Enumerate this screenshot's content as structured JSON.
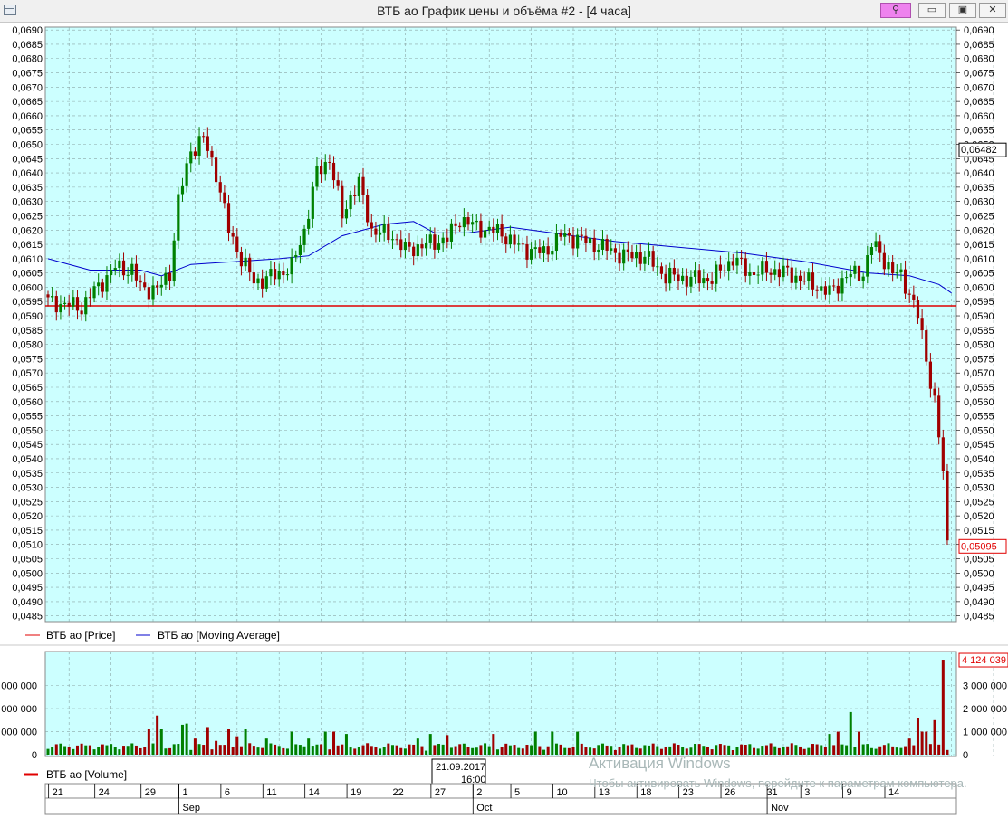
{
  "window": {
    "title": "ВТБ ао График цены и объёма #2 - [4 часа]",
    "buttons": {
      "pin": "⚲",
      "minimize": "▭",
      "restore": "▣",
      "close": "✕"
    }
  },
  "colors": {
    "up": "#008000",
    "down": "#a00000",
    "ma": "#0000cc",
    "level": "#e00000",
    "background": "#ccffff"
  },
  "chart_data": [
    {
      "type": "candlestick",
      "title": "",
      "price_axis": {
        "min": 0.0483,
        "max": 0.0691,
        "ticks": [
          "0,0485",
          "0,0490",
          "0,0495",
          "0,0500",
          "0,0505",
          "0,0510",
          "0,0515",
          "0,0520",
          "0,0525",
          "0,0530",
          "0,0535",
          "0,0540",
          "0,0545",
          "0,0550",
          "0,0555",
          "0,0560",
          "0,0565",
          "0,0570",
          "0,0575",
          "0,0580",
          "0,0585",
          "0,0590",
          "0,0595",
          "0,0600",
          "0,0605",
          "0,0610",
          "0,0615",
          "0,0620",
          "0,0625",
          "0,0630",
          "0,0635",
          "0,0640",
          "0,0645",
          "0,0650",
          "0,0655",
          "0,0660",
          "0,0665",
          "0,0670",
          "0,0675",
          "0,0680",
          "0,0685",
          "0,0690"
        ]
      },
      "horizontal_line": 0.05935,
      "price_labels": {
        "moving_average_last": "0,06482",
        "price_last": "0,05095"
      },
      "legend": [
        "ВТБ ао [Price]",
        "ВТБ ао [Moving Average]"
      ],
      "anchors": [
        {
          "i": 0,
          "p": 0.0595
        },
        {
          "i": 8,
          "p": 0.0593
        },
        {
          "i": 10,
          "p": 0.0597
        },
        {
          "i": 13,
          "p": 0.0602
        },
        {
          "i": 16,
          "p": 0.0607
        },
        {
          "i": 20,
          "p": 0.0606
        },
        {
          "i": 22,
          "p": 0.06
        },
        {
          "i": 26,
          "p": 0.0599
        },
        {
          "i": 29,
          "p": 0.0605
        },
        {
          "i": 31,
          "p": 0.063
        },
        {
          "i": 34,
          "p": 0.0648
        },
        {
          "i": 37,
          "p": 0.0652
        },
        {
          "i": 40,
          "p": 0.064
        },
        {
          "i": 43,
          "p": 0.062
        },
        {
          "i": 46,
          "p": 0.061
        },
        {
          "i": 49,
          "p": 0.0602
        },
        {
          "i": 52,
          "p": 0.0603
        },
        {
          "i": 55,
          "p": 0.0605
        },
        {
          "i": 58,
          "p": 0.0607
        },
        {
          "i": 61,
          "p": 0.062
        },
        {
          "i": 64,
          "p": 0.064
        },
        {
          "i": 67,
          "p": 0.0645
        },
        {
          "i": 70,
          "p": 0.0625
        },
        {
          "i": 72,
          "p": 0.0632
        },
        {
          "i": 74,
          "p": 0.0636
        },
        {
          "i": 77,
          "p": 0.062
        },
        {
          "i": 82,
          "p": 0.0618
        },
        {
          "i": 85,
          "p": 0.0613
        },
        {
          "i": 90,
          "p": 0.0615
        },
        {
          "i": 95,
          "p": 0.0617
        },
        {
          "i": 98,
          "p": 0.0624
        },
        {
          "i": 102,
          "p": 0.0621
        },
        {
          "i": 108,
          "p": 0.0619
        },
        {
          "i": 112,
          "p": 0.0614
        },
        {
          "i": 118,
          "p": 0.0612
        },
        {
          "i": 122,
          "p": 0.0618
        },
        {
          "i": 126,
          "p": 0.0617
        },
        {
          "i": 132,
          "p": 0.0614
        },
        {
          "i": 137,
          "p": 0.0611
        },
        {
          "i": 142,
          "p": 0.0611
        },
        {
          "i": 147,
          "p": 0.0604
        },
        {
          "i": 152,
          "p": 0.0603
        },
        {
          "i": 158,
          "p": 0.0603
        },
        {
          "i": 163,
          "p": 0.061
        },
        {
          "i": 167,
          "p": 0.0605
        },
        {
          "i": 172,
          "p": 0.0606
        },
        {
          "i": 176,
          "p": 0.0605
        },
        {
          "i": 182,
          "p": 0.0601
        },
        {
          "i": 186,
          "p": 0.0598
        },
        {
          "i": 190,
          "p": 0.0604
        },
        {
          "i": 194,
          "p": 0.0605
        },
        {
          "i": 196,
          "p": 0.0615
        },
        {
          "i": 198,
          "p": 0.0612
        },
        {
          "i": 201,
          "p": 0.0605
        },
        {
          "i": 203,
          "p": 0.0604
        },
        {
          "i": 205,
          "p": 0.0598
        },
        {
          "i": 207,
          "p": 0.059
        },
        {
          "i": 209,
          "p": 0.0575
        },
        {
          "i": 211,
          "p": 0.056
        },
        {
          "i": 213,
          "p": 0.0535
        },
        {
          "i": 214,
          "p": 0.051
        }
      ],
      "moving_average": [
        {
          "i": 0,
          "p": 0.061
        },
        {
          "i": 10,
          "p": 0.0606
        },
        {
          "i": 22,
          "p": 0.0606
        },
        {
          "i": 27,
          "p": 0.0604
        },
        {
          "i": 34,
          "p": 0.0608
        },
        {
          "i": 45,
          "p": 0.0609
        },
        {
          "i": 55,
          "p": 0.061
        },
        {
          "i": 62,
          "p": 0.0611
        },
        {
          "i": 70,
          "p": 0.0618
        },
        {
          "i": 80,
          "p": 0.0622
        },
        {
          "i": 87,
          "p": 0.0623
        },
        {
          "i": 92,
          "p": 0.0619
        },
        {
          "i": 100,
          "p": 0.0619
        },
        {
          "i": 110,
          "p": 0.0621
        },
        {
          "i": 120,
          "p": 0.0619
        },
        {
          "i": 135,
          "p": 0.0616
        },
        {
          "i": 150,
          "p": 0.0614
        },
        {
          "i": 165,
          "p": 0.0612
        },
        {
          "i": 180,
          "p": 0.0609
        },
        {
          "i": 195,
          "p": 0.0605
        },
        {
          "i": 205,
          "p": 0.0604
        },
        {
          "i": 212,
          "p": 0.0601
        },
        {
          "i": 215,
          "p": 0.0598
        }
      ]
    },
    {
      "type": "bar",
      "title": "",
      "volume_axis": {
        "min": 0,
        "max": 4400000,
        "ticks": [
          "0",
          "1 000 000",
          "2 000 000",
          "3 000 000"
        ]
      },
      "last_volume_label": "4 124 039",
      "legend": [
        "ВТБ ао [Volume]"
      ],
      "spikes": [
        {
          "i": 24,
          "v": 1100000
        },
        {
          "i": 26,
          "v": 1700000
        },
        {
          "i": 27,
          "v": 1100000
        },
        {
          "i": 32,
          "v": 1300000
        },
        {
          "i": 33,
          "v": 1350000
        },
        {
          "i": 35,
          "v": 700000
        },
        {
          "i": 38,
          "v": 1200000
        },
        {
          "i": 40,
          "v": 600000
        },
        {
          "i": 43,
          "v": 1100000
        },
        {
          "i": 45,
          "v": 800000
        },
        {
          "i": 47,
          "v": 1100000
        },
        {
          "i": 52,
          "v": 700000
        },
        {
          "i": 58,
          "v": 1000000
        },
        {
          "i": 62,
          "v": 700000
        },
        {
          "i": 66,
          "v": 1000000
        },
        {
          "i": 68,
          "v": 1000000
        },
        {
          "i": 71,
          "v": 900000
        },
        {
          "i": 88,
          "v": 700000
        },
        {
          "i": 91,
          "v": 900000
        },
        {
          "i": 95,
          "v": 850000
        },
        {
          "i": 106,
          "v": 900000
        },
        {
          "i": 116,
          "v": 1000000
        },
        {
          "i": 120,
          "v": 1000000
        },
        {
          "i": 126,
          "v": 1000000
        },
        {
          "i": 186,
          "v": 900000
        },
        {
          "i": 188,
          "v": 1000000
        },
        {
          "i": 191,
          "v": 1850000
        },
        {
          "i": 193,
          "v": 1000000
        },
        {
          "i": 205,
          "v": 700000
        },
        {
          "i": 207,
          "v": 1600000
        },
        {
          "i": 208,
          "v": 1000000
        },
        {
          "i": 209,
          "v": 1000000
        },
        {
          "i": 211,
          "v": 1500000
        },
        {
          "i": 213,
          "v": 4124039
        }
      ]
    }
  ],
  "time_axis": {
    "tooltip": [
      "21.09.2017",
      "16:00"
    ],
    "days": [
      {
        "label": "21",
        "i": 1
      },
      {
        "label": "24",
        "i": 12
      },
      {
        "label": "29",
        "i": 23
      },
      {
        "label": "1",
        "i": 32
      },
      {
        "label": "6",
        "i": 42
      },
      {
        "label": "11",
        "i": 52
      },
      {
        "label": "14",
        "i": 62
      },
      {
        "label": "19",
        "i": 72
      },
      {
        "label": "22",
        "i": 82
      },
      {
        "label": "27",
        "i": 92
      },
      {
        "label": "2",
        "i": 102
      },
      {
        "label": "5",
        "i": 111
      },
      {
        "label": "10",
        "i": 121
      },
      {
        "label": "13",
        "i": 131
      },
      {
        "label": "18",
        "i": 141
      },
      {
        "label": "23",
        "i": 151
      },
      {
        "label": "26",
        "i": 161
      },
      {
        "label": "31",
        "i": 171
      },
      {
        "label": "3",
        "i": 180
      },
      {
        "label": "9",
        "i": 190
      },
      {
        "label": "14",
        "i": 200
      }
    ],
    "months": [
      {
        "label": "Sep",
        "i": 32
      },
      {
        "label": "Oct",
        "i": 102
      },
      {
        "label": "Nov",
        "i": 172
      }
    ]
  },
  "watermark": {
    "title": "Активация Windows",
    "subtitle": "Чтобы активировать Windows, перейдите к параметрам компьютера."
  }
}
